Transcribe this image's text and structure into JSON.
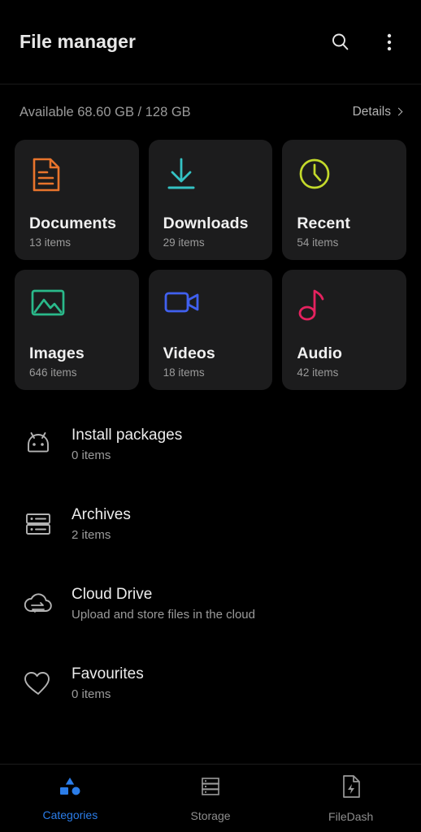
{
  "header": {
    "title": "File manager",
    "search_icon": "search-icon",
    "overflow_icon": "more-vertical-icon"
  },
  "storage": {
    "available_text": "Available 68.60 GB / 128 GB",
    "details_label": "Details"
  },
  "categories": [
    {
      "label": "Documents",
      "count": "13 items",
      "icon": "document-icon",
      "color": "#e8742c"
    },
    {
      "label": "Downloads",
      "count": "29 items",
      "icon": "download-icon",
      "color": "#34c2c4"
    },
    {
      "label": "Recent",
      "count": "54 items",
      "icon": "clock-icon",
      "color": "#c3d92b"
    },
    {
      "label": "Images",
      "count": "646 items",
      "icon": "image-icon",
      "color": "#2ab98a"
    },
    {
      "label": "Videos",
      "count": "18 items",
      "icon": "video-icon",
      "color": "#4060ef"
    },
    {
      "label": "Audio",
      "count": "42 items",
      "icon": "music-note-icon",
      "color": "#e5225f"
    }
  ],
  "list_items": [
    {
      "title": "Install packages",
      "subtitle": "0 items",
      "icon": "android-icon"
    },
    {
      "title": "Archives",
      "subtitle": "2 items",
      "icon": "archive-icon"
    },
    {
      "title": "Cloud Drive",
      "subtitle": "Upload and store files in the cloud",
      "icon": "cloud-sync-icon"
    },
    {
      "title": "Favourites",
      "subtitle": "0 items",
      "icon": "heart-icon"
    }
  ],
  "bottom_nav": {
    "active_color": "#2b7de9",
    "inactive_color": "#8e8e8e",
    "items": [
      {
        "label": "Categories",
        "icon": "shapes-icon",
        "active": true
      },
      {
        "label": "Storage",
        "icon": "storage-icon",
        "active": false
      },
      {
        "label": "FileDash",
        "icon": "file-bolt-icon",
        "active": false
      }
    ]
  }
}
